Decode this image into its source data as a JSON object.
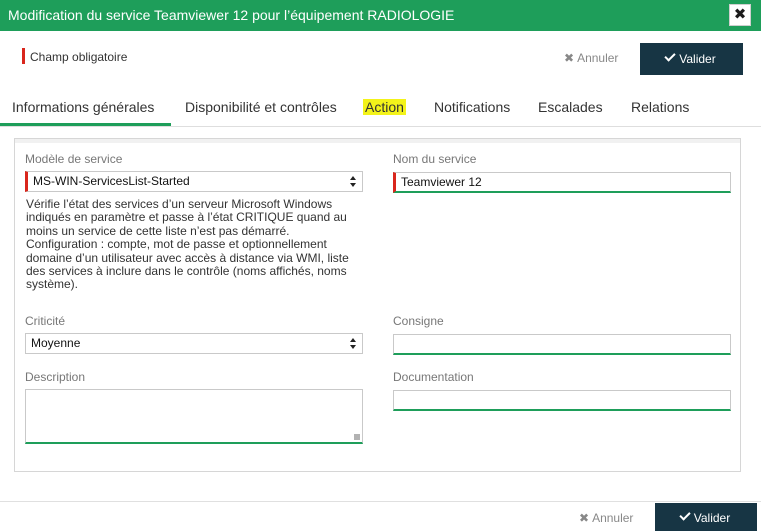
{
  "dialog": {
    "title": "Modification du service Teamviewer 12 pour l’équipement RADIOLOGIE",
    "close_symbol": "✖"
  },
  "required_hint": "Champ obligatoire",
  "actions": {
    "cancel_label": "Annuler",
    "cancel_symbol": "✖",
    "validate_label": "Valider"
  },
  "tabs": [
    {
      "label": "Informations générales",
      "active": true
    },
    {
      "label": "Disponibilité et contrôles",
      "active": false
    },
    {
      "label": "Action",
      "active": false,
      "highlighted": true
    },
    {
      "label": "Notifications",
      "active": false
    },
    {
      "label": "Escalades",
      "active": false
    },
    {
      "label": "Relations",
      "active": false
    }
  ],
  "form": {
    "service_model": {
      "label": "Modèle de service",
      "value": "MS-WIN-ServicesList-Started",
      "description_lines": [
        "Vérifie l’état des services d’un serveur Microsoft Windows indiqués en paramètre et passe à l’état CRITIQUE quand au moins un service de cette liste n’est pas démarré.",
        "Configuration : compte, mot de passe et optionnellement domaine d’un utilisateur avec accès à distance via WMI, liste des services à inclure dans le contrôle (noms affichés, noms système)."
      ]
    },
    "service_name": {
      "label": "Nom du service",
      "value": "Teamviewer 12"
    },
    "criticity": {
      "label": "Criticité",
      "value": "Moyenne"
    },
    "instruction": {
      "label": "Consigne",
      "value": ""
    },
    "description": {
      "label": "Description",
      "value": ""
    },
    "documentation": {
      "label": "Documentation",
      "value": ""
    }
  },
  "colors": {
    "title_bar": "#1e9e5a",
    "primary_button": "#173544",
    "required_marker": "#d9261c",
    "tab_highlight": "#f3f31a"
  }
}
